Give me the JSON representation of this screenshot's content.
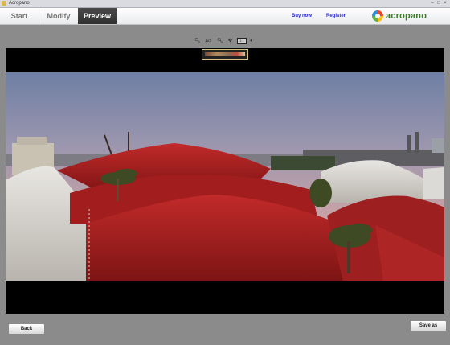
{
  "window": {
    "title": "Acropano"
  },
  "tabs": [
    {
      "label": "Start"
    },
    {
      "label": "Modify"
    },
    {
      "label": "Preview",
      "active": true
    }
  ],
  "header_links": {
    "buy": "Buy now",
    "register": "Register"
  },
  "logo": {
    "text": "acropano",
    "colors": [
      "#e64a2e",
      "#f2c21b",
      "#5bb34a",
      "#2f8fd6"
    ]
  },
  "zoom": {
    "level": "125",
    "fit": "1:1"
  },
  "buttons": {
    "back": "Back",
    "save": "Save as"
  },
  "colors": {
    "active_tab": "#3a3a3a",
    "link": "#2c2ccc",
    "background": "#8b8b8b",
    "viewer": "#000000"
  }
}
